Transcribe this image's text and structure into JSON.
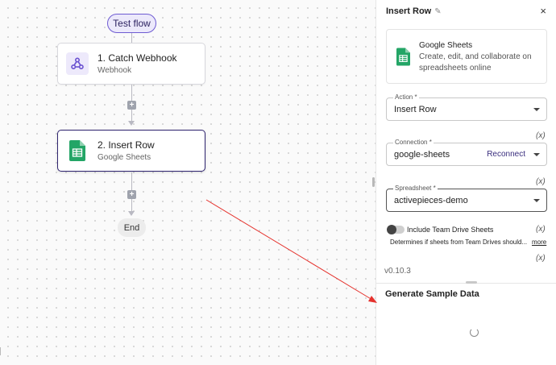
{
  "flow": {
    "test_flow_label": "Test flow",
    "steps": [
      {
        "title": "1. Catch Webhook",
        "subtitle": "Webhook"
      },
      {
        "title": "2. Insert Row",
        "subtitle": "Google Sheets"
      }
    ],
    "end_label": "End",
    "add_symbol": "+"
  },
  "panel": {
    "title": "Insert Row",
    "edit_icon": "pencil-icon",
    "close_symbol": "×",
    "piece": {
      "name": "Google Sheets",
      "description": "Create, edit, and collaborate on spreadsheets online"
    },
    "action": {
      "label": "Action *",
      "value": "Insert Row"
    },
    "connection": {
      "label": "Connection *",
      "value": "google-sheets",
      "reconnect_label": "Reconnect"
    },
    "spreadsheet": {
      "label": "Spreadsheet *",
      "value": "activepieces-demo"
    },
    "fx_symbol": "(x)",
    "team_drive": {
      "label": "Include Team Drive Sheets",
      "description": "Determines if sheets from Team Drives should...",
      "more_label": "more"
    },
    "version": "v0.10.3",
    "sample_data_title": "Generate Sample Data"
  },
  "colors": {
    "accent": "#2f2470",
    "sheets_green": "#23a566",
    "arrow_red": "#e5322d"
  }
}
